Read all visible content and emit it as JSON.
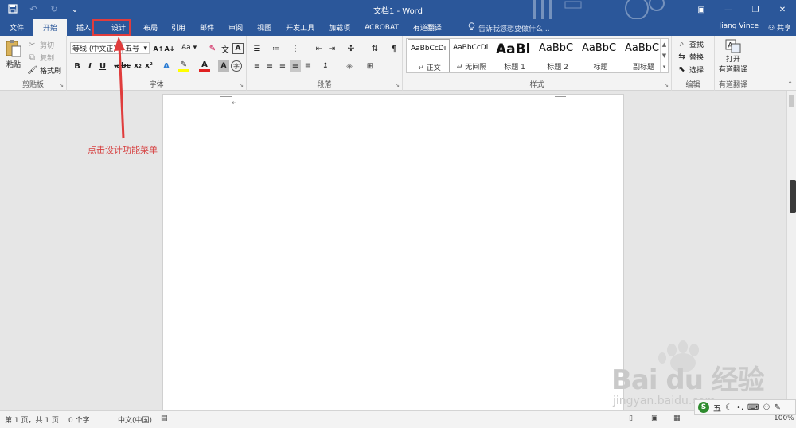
{
  "titlebar": {
    "title": "文档1 - Word",
    "save_icon": "save-icon",
    "undo_icon": "undo-icon",
    "redo_icon": "redo-icon",
    "customize_icon": "customize-quick-access-icon"
  },
  "tabs": [
    {
      "label": "文件"
    },
    {
      "label": "开始"
    },
    {
      "label": "插入"
    },
    {
      "label": "设计"
    },
    {
      "label": "布局"
    },
    {
      "label": "引用"
    },
    {
      "label": "邮件"
    },
    {
      "label": "审阅"
    },
    {
      "label": "视图"
    },
    {
      "label": "开发工具"
    },
    {
      "label": "加载项"
    },
    {
      "label": "ACROBAT"
    },
    {
      "label": "有道翻译"
    }
  ],
  "active_tab": "开始",
  "tell_me": "告诉我您想要做什么...",
  "account": {
    "user": "Jiang Vince",
    "share": "共享"
  },
  "clipboard": {
    "paste": "粘贴",
    "cut": "剪切",
    "copy": "复制",
    "format_painter": "格式刷",
    "label": "剪贴板"
  },
  "font": {
    "font_name": "等线 (中文正)",
    "font_size": "五号",
    "change_case": "Aa",
    "label": "字体"
  },
  "paragraph": {
    "label": "段落"
  },
  "styles": {
    "items": [
      {
        "preview": "AaBbCcDi",
        "name": "正文"
      },
      {
        "preview": "AaBbCcDi",
        "name": "无间隔"
      },
      {
        "preview": "AaBl",
        "name": "标题 1"
      },
      {
        "preview": "AaBbC",
        "name": "标题 2"
      },
      {
        "preview": "AaBbC",
        "name": "标题"
      },
      {
        "preview": "AaBbC",
        "name": "副标题"
      }
    ],
    "label": "样式"
  },
  "editing": {
    "find": "查找",
    "replace": "替换",
    "select": "选择",
    "label": "编辑"
  },
  "youdao": {
    "line1": "打开",
    "line2": "有道翻译",
    "label": "有道翻译"
  },
  "annotation": {
    "text": "点击设计功能菜单",
    "color": "#d64040"
  },
  "document": {
    "paragraph_mark": "↵"
  },
  "statusbar": {
    "page": "第 1 页，共 1 页",
    "words": "0 个字",
    "language": "中文(中国)",
    "zoom": "100%"
  },
  "ime": {
    "mode": "五"
  },
  "watermark": {
    "text": "Bai du 经验",
    "sub": "jingyan.baidu.com"
  },
  "colors": {
    "brand": "#2b579a",
    "ribbon": "#f3f3f3",
    "highlight_box": "#e03c3c"
  }
}
